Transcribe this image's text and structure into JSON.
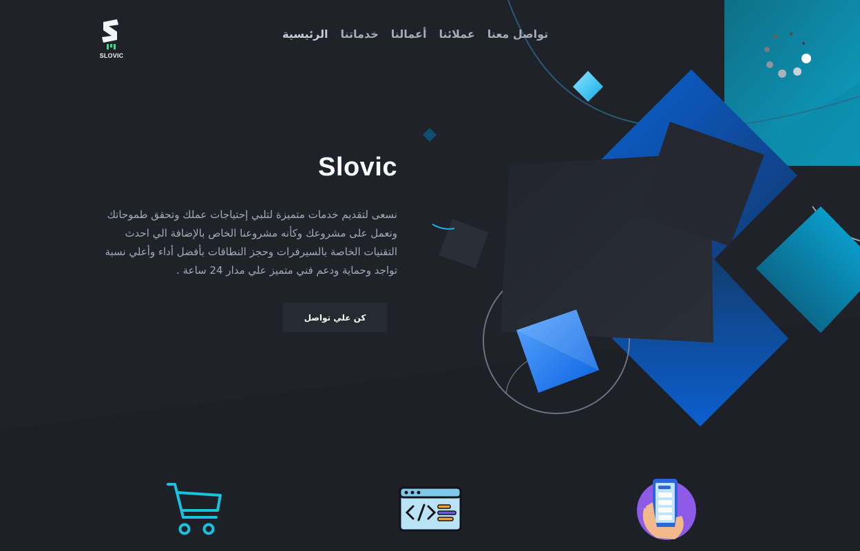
{
  "brand": {
    "logo_text": "SLOVIC",
    "title": "Slovic"
  },
  "nav": {
    "items": [
      {
        "label": "الرئيسية",
        "active": true
      },
      {
        "label": "خدماتنا",
        "active": false
      },
      {
        "label": "أعمالنا",
        "active": false
      },
      {
        "label": "عملائنا",
        "active": false
      },
      {
        "label": "تواصل معنا",
        "active": false
      }
    ]
  },
  "hero": {
    "description": "نسعى لتقديم خدمات متميزة لتلبي إحتياجات عملك وتحقق طموحاتك ونعمل على مشروعك وكأنه مشروعنا الخاص بالإضافة الي احدث التقنيات الخاصة بالسيرفرات وحجز النطاقات بأفضل أداء وأعلي نسبة تواجد وحماية ودعم فني متميز علي مدار 24 ساعة .",
    "cta_label": "كن علي تواصل"
  },
  "services": {
    "icons": [
      "shopping-cart-icon",
      "code-window-icon",
      "mobile-app-icon"
    ]
  },
  "colors": {
    "background": "#1f2229",
    "accent_blue": "#0b6fe0",
    "accent_cyan": "#18c1e8",
    "card_dark": "#262a32"
  }
}
